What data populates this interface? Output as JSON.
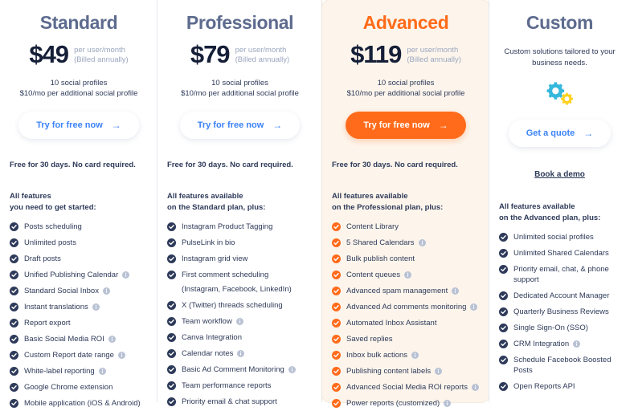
{
  "plans": [
    {
      "name": "Standard",
      "accent": false,
      "price": "$49",
      "price_unit": "per user/month",
      "price_billing": "(Billed annually)",
      "profiles": "10 social profiles",
      "profiles_extra": "$10/mo per additional social profile",
      "cta_label": "Try for free now",
      "cta_arrow": "→",
      "trial_note": "Free for 30 days. No card required.",
      "features_head_line1": "All features",
      "features_head_line2": "you need to get started:",
      "features": [
        {
          "label": "Posts scheduling",
          "info": false
        },
        {
          "label": "Unlimited posts",
          "info": false
        },
        {
          "label": "Draft posts",
          "info": false
        },
        {
          "label": "Unified Publishing Calendar",
          "info": true
        },
        {
          "label": "Standard Social Inbox",
          "info": true
        },
        {
          "label": "Instant translations",
          "info": true
        },
        {
          "label": "Report export",
          "info": false
        },
        {
          "label": "Basic Social Media ROI",
          "info": true
        },
        {
          "label": "Custom Report date range",
          "info": true
        },
        {
          "label": "White-label reporting",
          "info": true
        },
        {
          "label": "Google Chrome extension",
          "info": false
        },
        {
          "label": "Mobile application (iOS & Android)",
          "info": false
        }
      ]
    },
    {
      "name": "Professional",
      "accent": false,
      "price": "$79",
      "price_unit": "per user/month",
      "price_billing": "(Billed annually)",
      "profiles": "10 social profiles",
      "profiles_extra": "$10/mo per additional social profile",
      "cta_label": "Try for free now",
      "cta_arrow": "→",
      "trial_note": "Free for 30 days. No card required.",
      "features_head_line1": "All features available",
      "features_head_line2": "on the Standard plan, plus:",
      "features": [
        {
          "label": "Instagram Product Tagging",
          "info": false
        },
        {
          "label": "PulseLink in bio",
          "info": false
        },
        {
          "label": "Instagram grid view",
          "info": false
        },
        {
          "label": "First comment scheduling",
          "sub": "(Instagram, Facebook, LinkedIn)",
          "info": false
        },
        {
          "label": "X (Twitter) threads scheduling",
          "info": false
        },
        {
          "label": "Team workflow",
          "info": true
        },
        {
          "label": "Canva Integration",
          "info": false
        },
        {
          "label": "Calendar notes",
          "info": true
        },
        {
          "label": "Basic Ad Comment Monitoring",
          "info": true
        },
        {
          "label": "Team performance reports",
          "info": false
        },
        {
          "label": "Priority email & chat support",
          "info": false
        }
      ]
    },
    {
      "name": "Advanced",
      "accent": true,
      "price": "$119",
      "price_unit": "per user/month",
      "price_billing": "(Billed annually)",
      "profiles": "10 social profiles",
      "profiles_extra": "$10/mo per additional social profile",
      "cta_label": "Try for free now",
      "cta_arrow": "→",
      "trial_note": "Free for 30 days. No card required.",
      "features_head_line1": "All features available",
      "features_head_line2": "on the Professional plan, plus:",
      "features": [
        {
          "label": "Content Library",
          "info": false
        },
        {
          "label": "5 Shared Calendars",
          "info": true
        },
        {
          "label": "Bulk publish content",
          "info": false
        },
        {
          "label": "Content queues",
          "info": true
        },
        {
          "label": "Advanced spam management",
          "info": true
        },
        {
          "label": "Advanced Ad comments monitoring",
          "info": true
        },
        {
          "label": "Automated Inbox Assistant",
          "info": false
        },
        {
          "label": "Saved replies",
          "info": false
        },
        {
          "label": "Inbox bulk actions",
          "info": true
        },
        {
          "label": "Publishing content labels",
          "info": true
        },
        {
          "label": "Advanced Social Media ROI reports",
          "info": true
        },
        {
          "label": "Power reports (customized)",
          "info": true
        }
      ]
    },
    {
      "name": "Custom",
      "accent": false,
      "description": "Custom solutions tailored to your business needs.",
      "cta_label": "Get a quote",
      "cta_arrow": "→",
      "demo_link": "Book a demo",
      "features_head_line1": "All features available",
      "features_head_line2": "on the Advanced plan, plus:",
      "features": [
        {
          "label": "Unlimited social profiles",
          "info": false
        },
        {
          "label": "Unlimited Shared Calendars",
          "info": false
        },
        {
          "label": "Priority email, chat, & phone support",
          "info": false
        },
        {
          "label": "Dedicated Account Manager",
          "info": false
        },
        {
          "label": "Quarterly Business Reviews",
          "info": false
        },
        {
          "label": "Single Sign-On (SSO)",
          "info": false
        },
        {
          "label": "CRM Integration",
          "info": true
        },
        {
          "label": "Schedule Facebook Boosted Posts",
          "info": false
        },
        {
          "label": "Open Reports API",
          "info": false
        }
      ]
    }
  ],
  "icons": {
    "check": "check-circle-icon",
    "info": "info-circle-icon",
    "gear_primary": "gear-icon",
    "gear_secondary": "gear-small-icon",
    "arrow": "arrow-right-icon"
  },
  "colors": {
    "accent_orange": "#ff6b1a",
    "link_blue": "#3b82f6",
    "heading_slate": "#5d6b8e",
    "text_navy": "#2e3a59",
    "check_navy": "#2e3a59",
    "info_gray": "#b9c2d4",
    "highlight_bg": "#fdf5ec",
    "gear_teal": "#35b8dc",
    "gear_yellow": "#ffd21e"
  }
}
